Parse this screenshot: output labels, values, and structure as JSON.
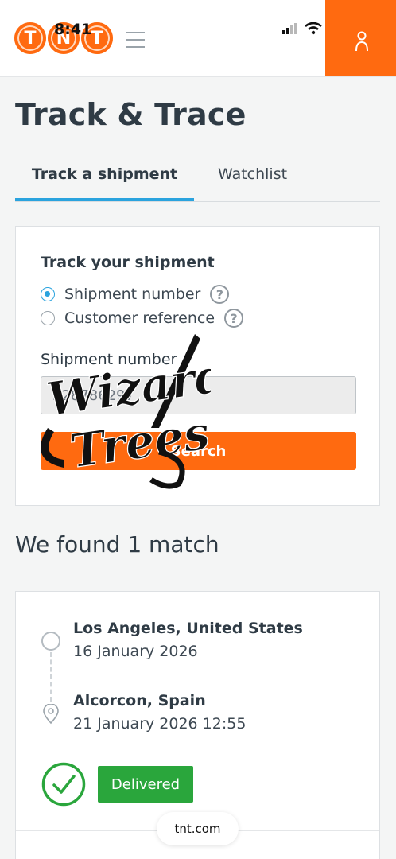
{
  "status_bar": {
    "time": "8:41"
  },
  "brand": {
    "logo_letters": [
      "T",
      "N",
      "T"
    ],
    "accent": "#ff6a10",
    "blue": "#2aa3de",
    "green": "#2aa63c"
  },
  "page": {
    "title": "Track & Trace"
  },
  "tabs": [
    {
      "label": "Track a shipment",
      "active": true
    },
    {
      "label": "Watchlist",
      "active": false
    }
  ],
  "track_form": {
    "heading": "Track your shipment",
    "options": [
      {
        "label": "Shipment number",
        "selected": true
      },
      {
        "label": "Customer reference",
        "selected": false
      }
    ],
    "help_glyph": "?",
    "field_label": "Shipment number",
    "field_value": "528786297",
    "search_label": "Search"
  },
  "watermark": {
    "line1": "Wizard",
    "line2": "Trees"
  },
  "results": {
    "heading": "We found 1 match",
    "origin": {
      "place": "Los Angeles, United States",
      "date": "16 January 2026"
    },
    "destination": {
      "place": "Alcorcon, Spain",
      "date": "21 January 2026 12:55"
    },
    "status": "Delivered"
  },
  "browser": {
    "url": "tnt.com"
  }
}
